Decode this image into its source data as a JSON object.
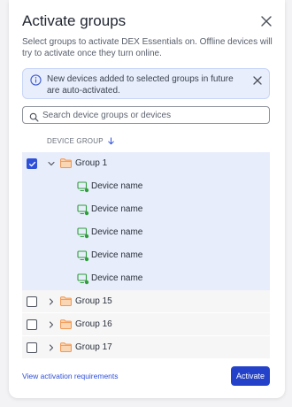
{
  "dialog": {
    "title": "Activate groups",
    "description": "Select groups to activate DEX Essentials on. Offline devices will try to activate once they turn online.",
    "banner_text": "New devices added to selected groups in future are auto-activated."
  },
  "search": {
    "placeholder": "Search device groups or devices",
    "value": ""
  },
  "table": {
    "column_header": "DEVICE GROUP",
    "sort_direction": "descending"
  },
  "groups": [
    {
      "name": "Group 1",
      "checked": true,
      "expanded": true,
      "devices": [
        "Device name",
        "Device name",
        "Device name",
        "Device name",
        "Device name"
      ]
    },
    {
      "name": "Group 15",
      "checked": false,
      "expanded": false,
      "devices": []
    },
    {
      "name": "Group 16",
      "checked": false,
      "expanded": false,
      "devices": []
    },
    {
      "name": "Group 17",
      "checked": false,
      "expanded": false,
      "devices": []
    }
  ],
  "footer": {
    "link_label": "View activation requirements",
    "primary_button": "Activate"
  },
  "colors": {
    "accent": "#2f50d8",
    "primary_button": "#2442c9",
    "selected_row": "#e8edfb",
    "folder": "#f4a261",
    "device_online": "#2e9e3a"
  },
  "icons": {
    "close": "close-icon",
    "info": "info-icon",
    "search": "search-icon",
    "sort": "arrow-down-icon",
    "expand": "chevron-icon",
    "folder": "folder-icon",
    "device": "monitor-icon"
  }
}
